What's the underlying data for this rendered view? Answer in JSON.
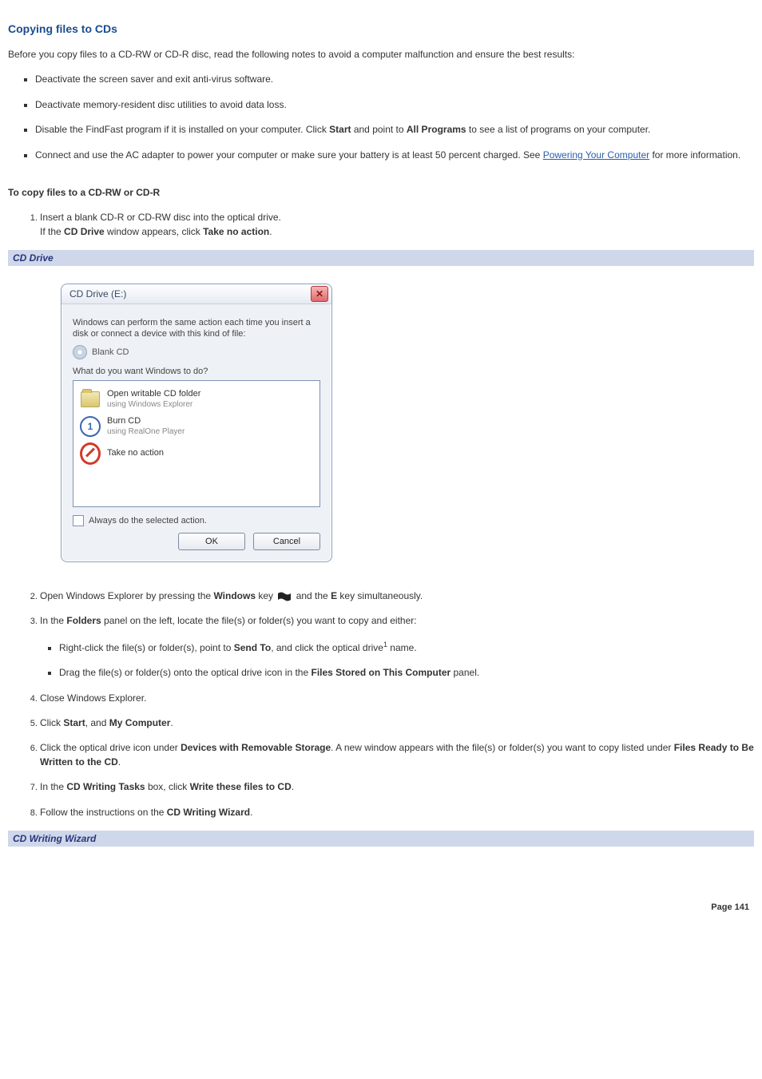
{
  "title": "Copying files to CDs",
  "intro": "Before you copy files to a CD-RW or CD-R disc, read the following notes to avoid a computer malfunction and ensure the best results:",
  "notes": {
    "n1": "Deactivate the screen saver and exit anti-virus software.",
    "n2": "Deactivate memory-resident disc utilities to avoid data loss.",
    "n3a": "Disable the FindFast program if it is installed on your computer. Click ",
    "n3b": "Start",
    "n3c": " and point to ",
    "n3d": "All Programs",
    "n3e": " to see a list of programs on your computer.",
    "n4a": "Connect and use the AC adapter to power your computer or make sure your battery is at least 50 percent charged. See ",
    "n4b": "Powering Your Computer",
    "n4c": " for more information."
  },
  "subhead1": "To copy files to a CD-RW or CD-R",
  "step1": {
    "a": "Insert a blank CD-R or CD-RW disc into the optical drive.",
    "b_pre": "If the ",
    "b_bold": "CD Drive",
    "b_mid": " window appears, click ",
    "b_bold2": "Take no action",
    "b_end": "."
  },
  "banner1": "CD Drive",
  "dialog": {
    "title": "CD Drive (E:)",
    "line1": "Windows can perform the same action each time you insert a disk or connect a device with this kind of file:",
    "blank": "Blank CD",
    "prompt": "What do you want Windows to do?",
    "opt1a": "Open writable CD folder",
    "opt1b": "using Windows Explorer",
    "opt2a": "Burn CD",
    "opt2b": "using RealOne Player",
    "opt3": "Take no action",
    "check": "Always do the selected action.",
    "ok": "OK",
    "cancel": "Cancel"
  },
  "step2": {
    "a": "Open Windows Explorer by pressing the ",
    "b": "Windows",
    "c": " key ",
    "d": "and the ",
    "e": "E",
    "f": " key simultaneously."
  },
  "step3": {
    "a": "In the ",
    "b": "Folders",
    "c": " panel on the left, locate the file(s) or folder(s) you want to copy and either:",
    "sub1a": "Right-click the file(s) or folder(s), point to ",
    "sub1b": "Send To",
    "sub1c": ", and click the optical drive",
    "sub1star": "1",
    "sub1d": " name.",
    "sub2a": "Drag the file(s) or folder(s) onto the optical drive icon in the ",
    "sub2b": "Files Stored on This Computer",
    "sub2c": " panel."
  },
  "step4": "Close Windows Explorer.",
  "step5": {
    "a": "Click ",
    "b": "Start",
    "c": ", and ",
    "d": "My Computer",
    "e": "."
  },
  "step6": {
    "a": "Click the optical drive icon under ",
    "b": "Devices with Removable Storage",
    "c": ". A new window appears with the file(s) or folder(s) you want to copy listed under ",
    "d": "Files Ready to Be Written to the CD",
    "e": "."
  },
  "step7": {
    "a": "In the ",
    "b": "CD Writing Tasks",
    "c": " box, click ",
    "d": "Write these files to CD",
    "e": "."
  },
  "step8": {
    "a": "Follow the instructions on the ",
    "b": "CD Writing Wizard",
    "c": "."
  },
  "banner2": "CD Writing Wizard",
  "page": "Page 141"
}
